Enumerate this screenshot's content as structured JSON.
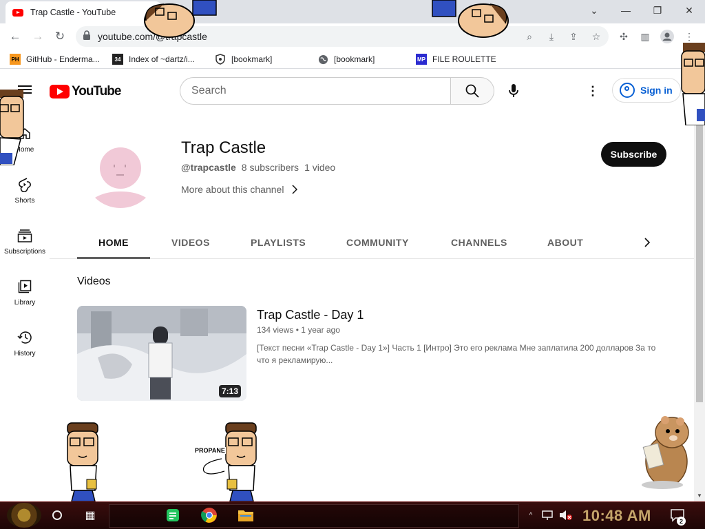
{
  "browser": {
    "tab_title": "Trap Castle - YouTube",
    "url": "youtube.com/@trapcastle",
    "bookmarks": [
      {
        "icon": "PH",
        "label": "GitHub - Enderma..."
      },
      {
        "icon": "34",
        "label": "Index of ~dartz/i..."
      },
      {
        "icon": "shield",
        "label": "[bookmark]"
      },
      {
        "icon": "globe",
        "label": "[bookmark]"
      },
      {
        "icon": "MP",
        "label": "FILE ROULETTE"
      }
    ]
  },
  "youtube": {
    "logo": "YouTube",
    "search_placeholder": "Search",
    "signin_label": "Sign in",
    "sidebar": [
      {
        "label": "Home",
        "icon": "home-icon"
      },
      {
        "label": "Shorts",
        "icon": "shorts-icon"
      },
      {
        "label": "Subscriptions",
        "icon": "subscriptions-icon"
      },
      {
        "label": "Library",
        "icon": "library-icon"
      },
      {
        "label": "History",
        "icon": "history-icon"
      }
    ]
  },
  "channel": {
    "name": "Trap Castle",
    "handle": "@trapcastle",
    "subscribers": "8 subscribers",
    "videos_count": "1 video",
    "more_about": "More about this channel",
    "subscribe_label": "Subscribe",
    "tabs": [
      "HOME",
      "VIDEOS",
      "PLAYLISTS",
      "COMMUNITY",
      "CHANNELS",
      "ABOUT"
    ],
    "active_tab": "HOME"
  },
  "videos_section": {
    "title": "Videos",
    "items": [
      {
        "title": "Trap Castle - Day 1",
        "views": "134 views",
        "age": "1 year ago",
        "duration": "7:13",
        "description": "[Текст песни «Trap Castle - Day 1»] Часть 1 [Интро] Это его реклама Мне заплатила 200 долларов За то что я рекламирую..."
      }
    ]
  },
  "desktop": {
    "sticker_text": "PROPANE",
    "clock": "10:48 AM",
    "notification_count": "2"
  },
  "colors": {
    "youtube_red": "#ff0000",
    "link_blue": "#065fd4",
    "subscribe_bg": "#0f0f0f",
    "taskbar_bg": "#2a0909",
    "clock_gold": "#c4a46a"
  }
}
